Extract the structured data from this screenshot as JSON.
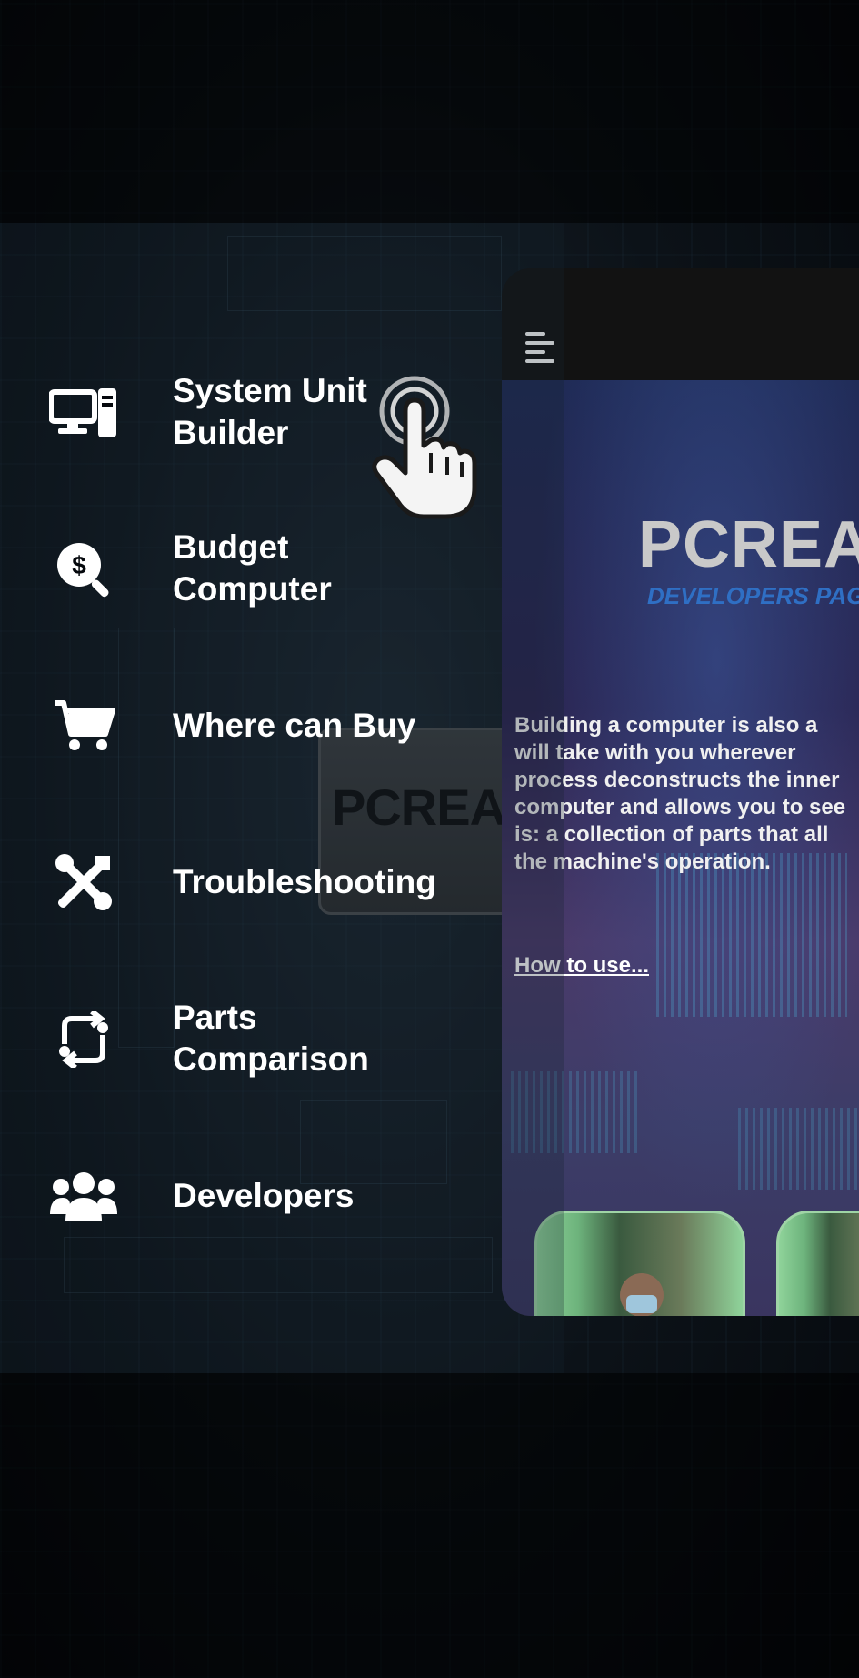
{
  "menu": {
    "items": [
      {
        "label_line1": "System Unit",
        "label_line2": "Builder",
        "icon": "desktop-computer-icon"
      },
      {
        "label_line1": "Budget",
        "label_line2": "Computer",
        "icon": "search-dollar-icon"
      },
      {
        "label_line1": "Where can Buy",
        "label_line2": "",
        "icon": "shopping-cart-icon"
      },
      {
        "label_line1": "Troubleshooting",
        "label_line2": "",
        "icon": "tools-icon"
      },
      {
        "label_line1": "Parts",
        "label_line2": "Comparison",
        "icon": "sync-compare-icon"
      },
      {
        "label_line1": "Developers",
        "label_line2": "",
        "icon": "users-icon"
      }
    ]
  },
  "background": {
    "chip_text": "PCREATE"
  },
  "preview": {
    "brand": "PCREAT",
    "subtitle": "DEVELOPERS PAG",
    "description_lines": [
      "Building a computer is also a",
      "will take with you wherever",
      "process deconstructs the inner",
      "computer and allows you to see",
      "is: a collection of parts that all",
      "the machine's operation."
    ],
    "how_to_use": "How to use..."
  },
  "colors": {
    "accent_blue": "#2f6fc4",
    "menu_text": "#ffffff",
    "background": "#05080d"
  }
}
